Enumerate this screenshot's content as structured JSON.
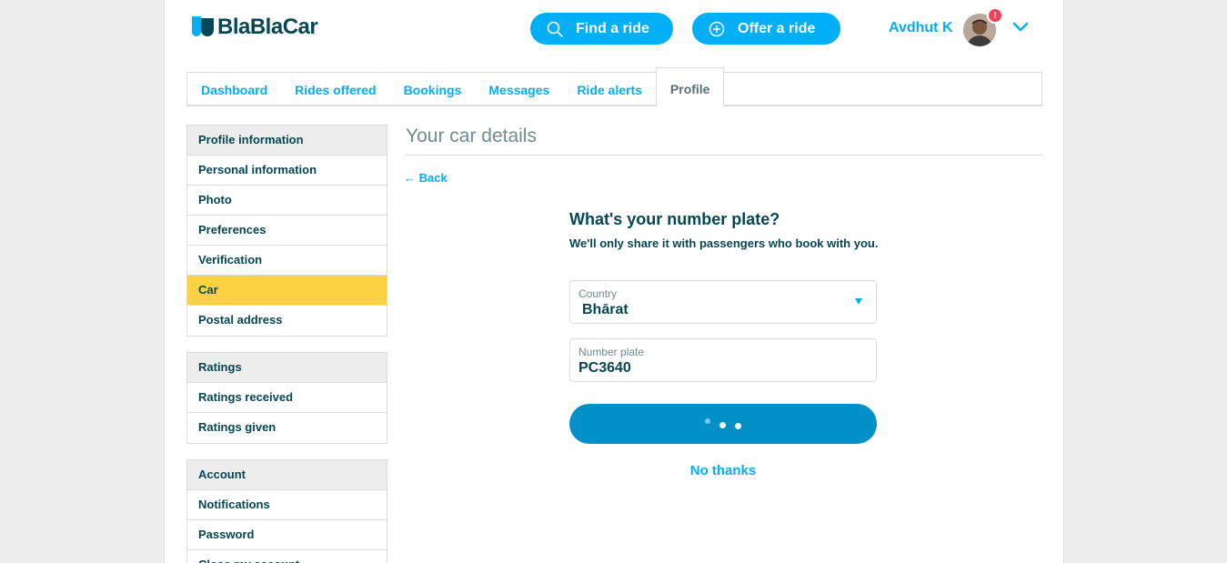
{
  "brand": {
    "name": "BlaBlaCar"
  },
  "header": {
    "find_ride_label": "Find a ride",
    "offer_ride_label": "Offer a ride",
    "user_name": "Avdhut K",
    "notification_badge": "!"
  },
  "tabs": [
    {
      "label": "Dashboard"
    },
    {
      "label": "Rides offered"
    },
    {
      "label": "Bookings"
    },
    {
      "label": "Messages"
    },
    {
      "label": "Ride alerts"
    },
    {
      "label": "Profile",
      "active": true
    }
  ],
  "sidebar": {
    "profile": {
      "heading": "Profile information",
      "items": [
        "Personal information",
        "Photo",
        "Preferences",
        "Verification",
        "Car",
        "Postal address"
      ],
      "active": "Car"
    },
    "ratings": {
      "heading": "Ratings",
      "items": [
        "Ratings received",
        "Ratings given"
      ]
    },
    "account": {
      "heading": "Account",
      "items": [
        "Notifications",
        "Password",
        "Close my account"
      ]
    }
  },
  "main": {
    "title": "Your car details",
    "back_label": "← Back",
    "question": "What's your number plate?",
    "subtitle": "We'll only share it with passengers who book with you.",
    "country": {
      "label": "Country",
      "value": "Bhārat"
    },
    "plate": {
      "label": "Number plate",
      "value": "PC3640"
    },
    "no_thanks_label": "No thanks"
  },
  "colors": {
    "accent": "#00aff5",
    "dark": "#054752",
    "active_item": "#fdd242",
    "submit_button": "#0190c7",
    "badge": "#f53f5b"
  }
}
